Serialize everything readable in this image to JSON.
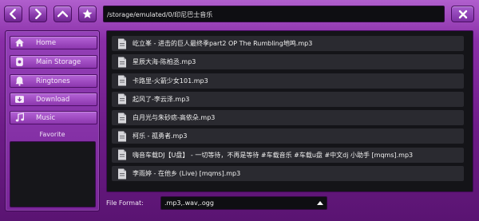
{
  "path": "/storage/emulated/0/印尼巴士音乐",
  "nav": {
    "buttons": [
      {
        "name": "back-button",
        "icon": "chevron-left-icon"
      },
      {
        "name": "forward-button",
        "icon": "chevron-right-icon"
      },
      {
        "name": "up-button",
        "icon": "chevron-up-icon"
      },
      {
        "name": "favorite-button",
        "icon": "star-icon"
      }
    ],
    "close_icon": "close-icon"
  },
  "sidebar": {
    "items": [
      {
        "label": "Home",
        "icon": "home-icon"
      },
      {
        "label": "Main Storage",
        "icon": "storage-icon"
      },
      {
        "label": "Ringtones",
        "icon": "ringtone-icon"
      },
      {
        "label": "Download",
        "icon": "download-icon"
      },
      {
        "label": "Music",
        "icon": "music-icon"
      }
    ],
    "favorite_label": "Favorite"
  },
  "files": [
    "屹立峯 - 进击的巨人最终季part2 OP The Rumbling地鸣.mp3",
    "星辰大海-陈柏丞.mp3",
    "卡路里-火箭少女101.mp3",
    "起风了-李云泽.mp3",
    "白月光与朱砂痣-高依朵.mp3",
    "柯乐 - 孤勇者.mp3",
    "嗨音车载DJ【U盘】 - 一切等待，不再是等待 #车载音乐 #车载u盘 #中文dj 小助手 [mqms].mp3",
    "李雨婷 - 在他乡 (Live) [mqms].mp3"
  ],
  "file_format": {
    "label": "File Format:",
    "value": ".mp3,.wav,.ogg"
  },
  "colors": {
    "accent": "#8a2fa8",
    "list_bg": "#141418",
    "row_bg": "#2a2a30"
  }
}
